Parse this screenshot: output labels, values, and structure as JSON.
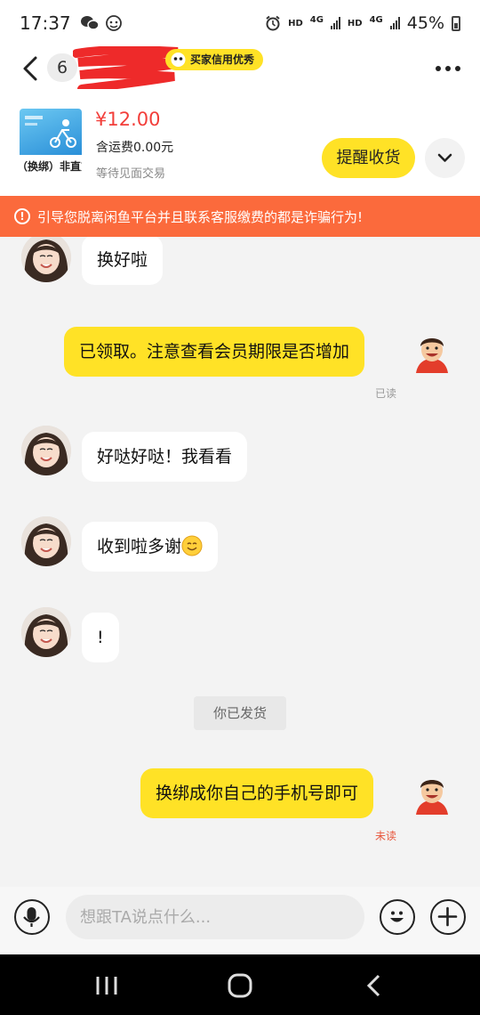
{
  "status_bar": {
    "time": "17:37",
    "net1": "HD",
    "net2": "4G",
    "net3": "HD",
    "net4": "4G",
    "battery": "45%"
  },
  "header": {
    "unread_count": "6",
    "credit_badge": "买家信用优秀"
  },
  "product": {
    "thumb_caption": "（换绑）非直充",
    "price": "¥12.00",
    "shipping": "含运费0.00元",
    "trade_status": "等待见面交易",
    "remind_button": "提醒收货"
  },
  "warning": {
    "icon_text": "!",
    "text": "引导您脱离闲鱼平台并且联系客服缴费的都是诈骗行为!"
  },
  "messages": [
    {
      "side": "left",
      "text": "换好啦"
    },
    {
      "side": "right",
      "text": "已领取。注意查看会员期限是否增加",
      "receipt": "已读"
    },
    {
      "side": "left",
      "text": "好哒好哒！我看看"
    },
    {
      "side": "left",
      "text": "收到啦多谢",
      "emoji": "smile-emoji"
    },
    {
      "side": "left",
      "text": "!"
    },
    {
      "side": "system",
      "text": "你已发货"
    },
    {
      "side": "right",
      "text": "换绑成你自己的手机号即可",
      "receipt": "未读"
    }
  ],
  "input": {
    "placeholder": "想跟TA说点什么..."
  },
  "colors": {
    "accent_yellow": "#ffe226",
    "price_red": "#f23e3a",
    "warning_orange": "#fb6a3c",
    "unread_red": "#e8573d"
  },
  "icons": [
    "back-icon",
    "more-icon",
    "chevron-down-icon",
    "warning-icon",
    "microphone-icon",
    "emoji-icon",
    "plus-icon",
    "recent-apps-icon",
    "home-icon",
    "nav-back-icon"
  ]
}
